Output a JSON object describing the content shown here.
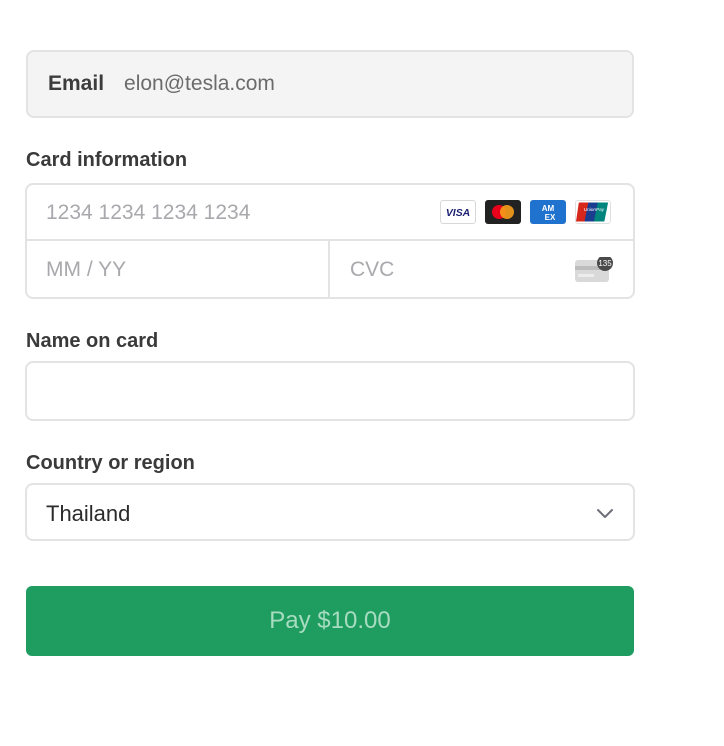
{
  "email": {
    "label": "Email",
    "value": "elon@tesla.com"
  },
  "card": {
    "section_label": "Card information",
    "number_placeholder": "1234 1234 1234 1234",
    "expiry_placeholder": "MM / YY",
    "cvc_placeholder": "CVC",
    "cvc_icon_text": "135",
    "brands": [
      {
        "name": "visa-icon",
        "text": "VISA",
        "color": "#1a1f71"
      },
      {
        "name": "mastercard-icon",
        "text": "",
        "color": "#222222"
      },
      {
        "name": "amex-icon",
        "text": "AM EX",
        "color": "#1f72cd"
      },
      {
        "name": "unionpay-icon",
        "text": "UnionPay",
        "color": "#d7261b"
      }
    ]
  },
  "name_on_card": {
    "label": "Name on card",
    "value": ""
  },
  "country": {
    "label": "Country or region",
    "value": "Thailand"
  },
  "pay_button": {
    "label": "Pay $10.00",
    "color": "#1f9d61"
  }
}
